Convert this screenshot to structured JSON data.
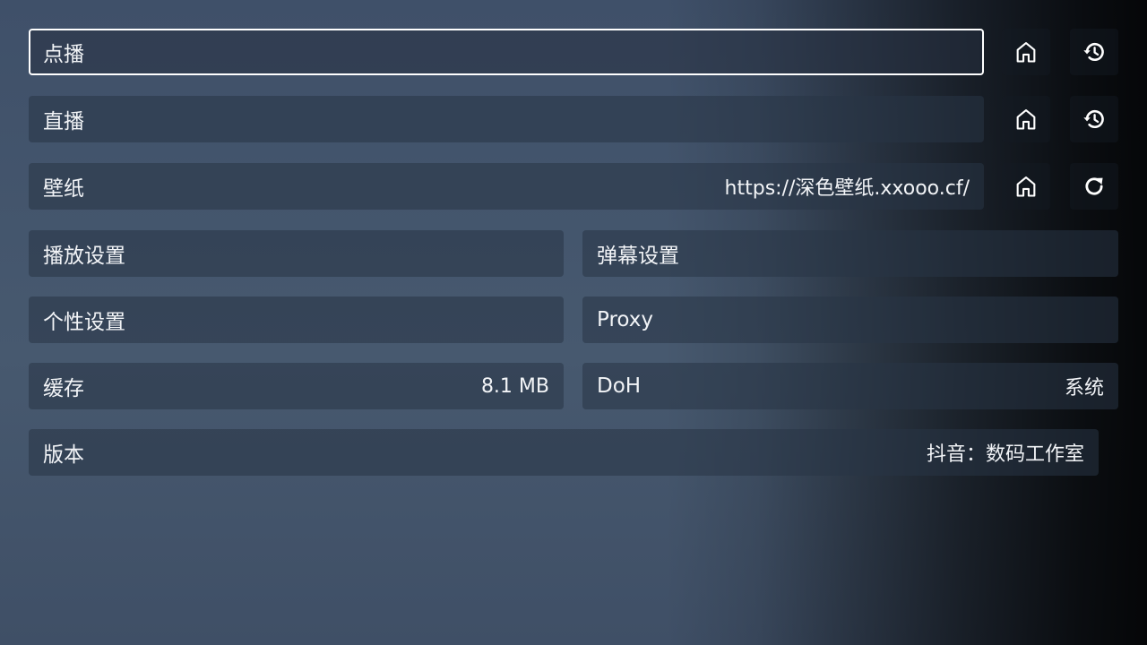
{
  "rows": {
    "vod": {
      "label": "点播",
      "home_icon": "home-icon",
      "history_icon": "history-icon"
    },
    "live": {
      "label": "直播",
      "home_icon": "home-icon",
      "history_icon": "history-icon"
    },
    "wallpaper": {
      "label": "壁纸",
      "value": "https://深色壁纸.xxooo.cf/",
      "home_icon": "home-icon",
      "refresh_icon": "refresh-icon"
    },
    "player_settings": {
      "label": "播放设置"
    },
    "danmaku_settings": {
      "label": "弹幕设置"
    },
    "personal_settings": {
      "label": "个性设置"
    },
    "proxy": {
      "label": "Proxy"
    },
    "cache": {
      "label": "缓存",
      "value": "8.1 MB"
    },
    "doh": {
      "label": "DoH",
      "value": "系统"
    },
    "version": {
      "label": "版本",
      "value": "抖音：数码工作室"
    }
  },
  "colors": {
    "background_start": "#3f5069",
    "background_end": "#0b0e13",
    "field_bg": "#2f3d52",
    "text": "#f2f4f7",
    "focus_border": "#ffffff"
  }
}
